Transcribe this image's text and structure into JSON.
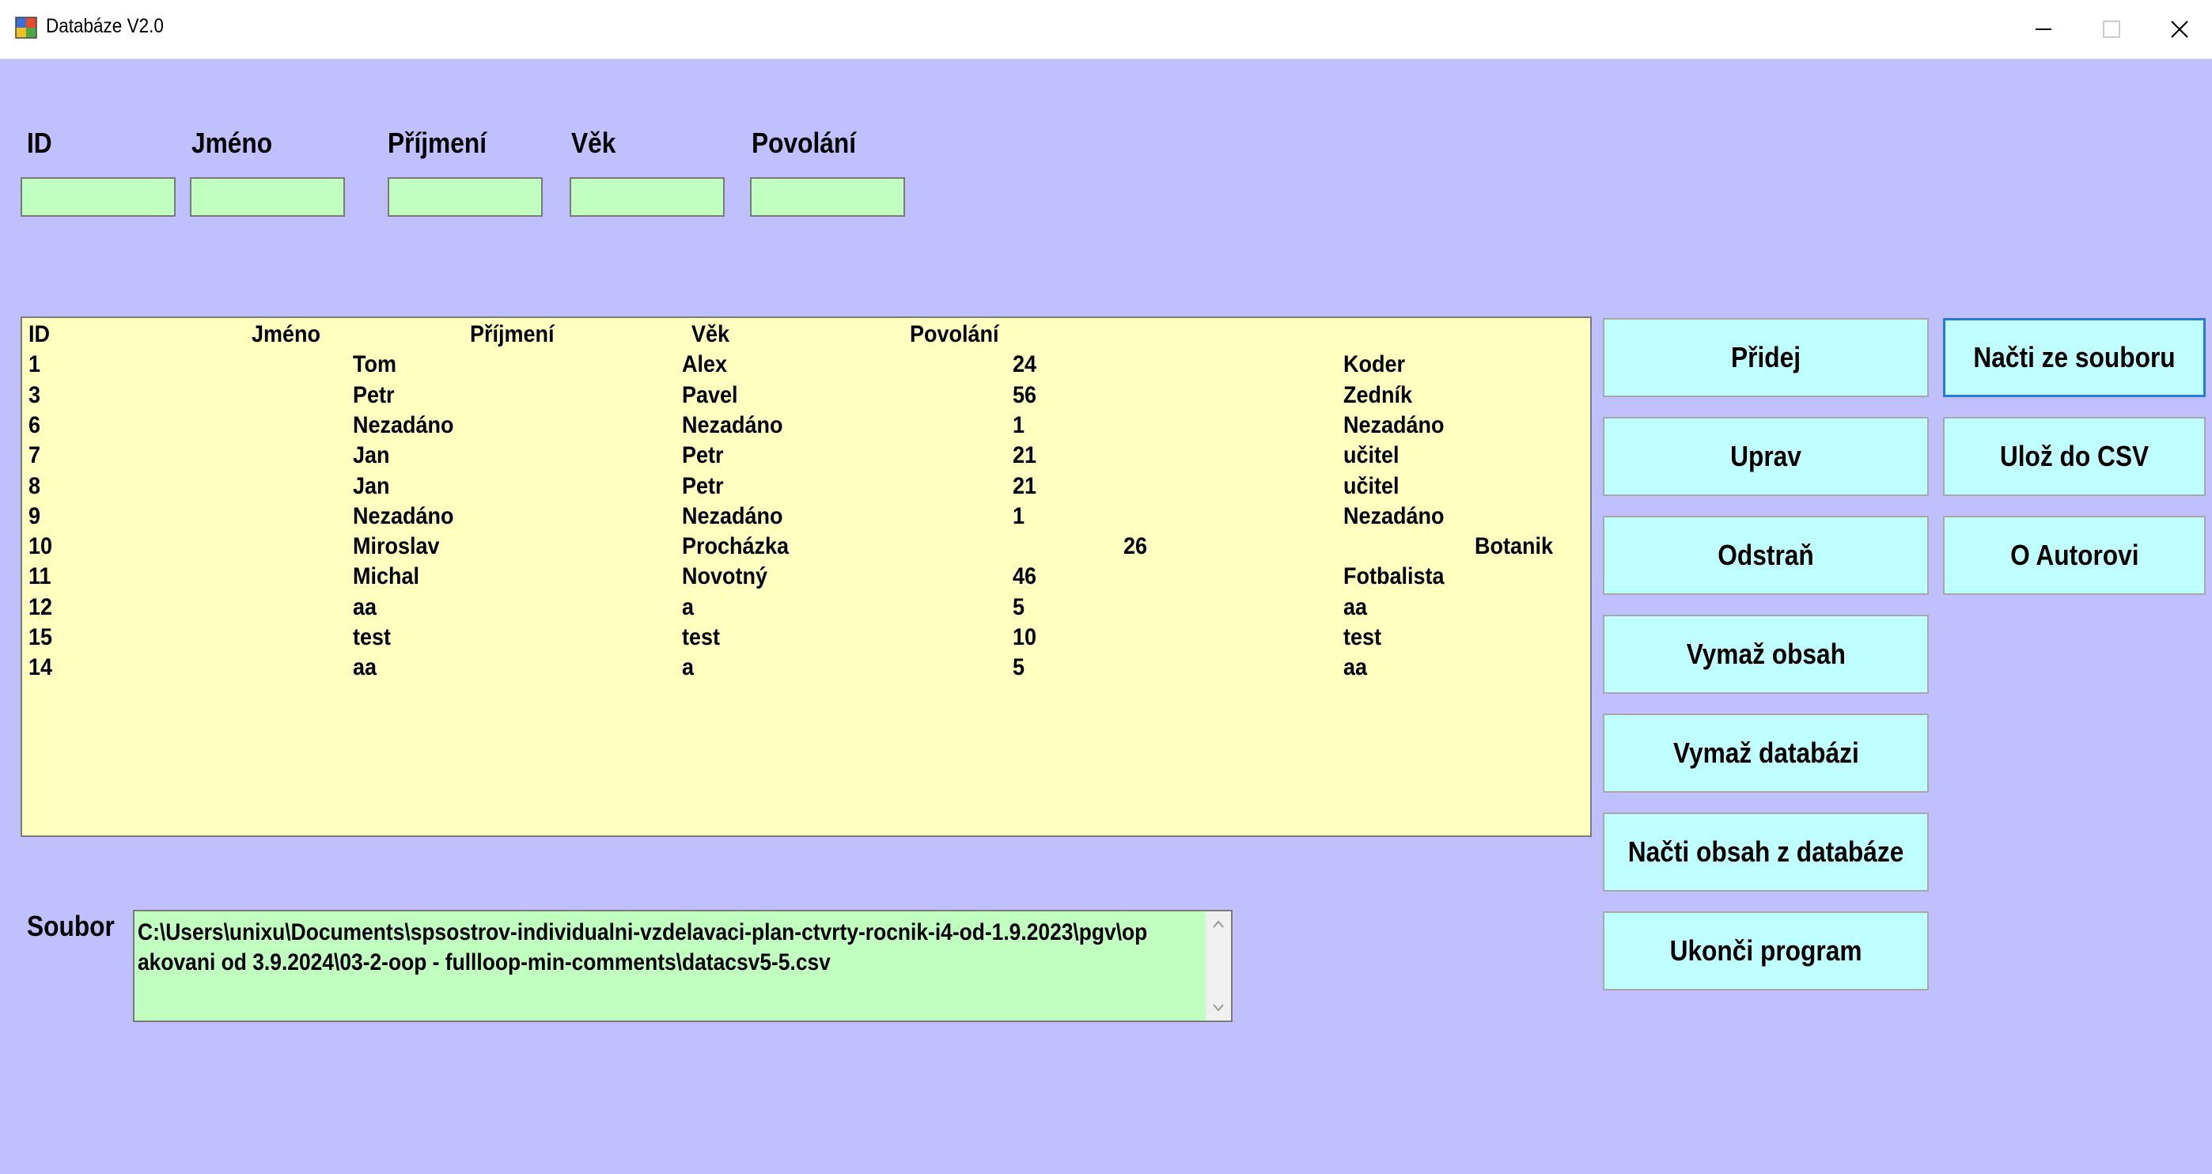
{
  "window": {
    "title": "Databáze V2.0"
  },
  "fields": [
    {
      "label": "ID",
      "value": ""
    },
    {
      "label": "Jméno",
      "value": ""
    },
    {
      "label": "Příjmení",
      "value": ""
    },
    {
      "label": "Věk",
      "value": ""
    },
    {
      "label": "Povolání",
      "value": ""
    }
  ],
  "list": {
    "header": [
      "ID",
      "Jméno",
      "Příjmení",
      "Věk",
      "Povolání"
    ],
    "rows": [
      [
        "1",
        "Tom",
        "Alex",
        "24",
        "Koder"
      ],
      [
        "3",
        "Petr",
        "Pavel",
        "56",
        "Zedník"
      ],
      [
        "6",
        "Nezadáno",
        "Nezadáno",
        "1",
        "Nezadáno"
      ],
      [
        "7",
        "Jan",
        "Petr",
        "21",
        "učitel"
      ],
      [
        "8",
        "Jan",
        "Petr",
        "21",
        "učitel"
      ],
      [
        "9",
        "Nezadáno",
        "Nezadáno",
        "1",
        "Nezadáno"
      ],
      [
        "10",
        "Miroslav",
        "Procházka",
        "26",
        "Botanik"
      ],
      [
        "11",
        "Michal",
        "Novotný",
        "46",
        "Fotbalista"
      ],
      [
        "12",
        "aa",
        "a",
        "5",
        "aa"
      ],
      [
        "15",
        "test",
        "test",
        "10",
        "test"
      ],
      [
        "14",
        "aa",
        "a",
        "5",
        "aa"
      ]
    ]
  },
  "buttons": {
    "pridej": "Přidej",
    "uprav": "Uprav",
    "odstran": "Odstraň",
    "vymaz_obsah": "Vymaž obsah",
    "vymaz_databazi": "Vymaž databázi",
    "nacti_obsah_z_databaze": "Načti obsah z databáze",
    "ukonci_program": "Ukonči program",
    "nacti_ze_souboru": "Načti ze souboru",
    "uloz_do_csv": "Ulož do CSV",
    "o_autorovi": "O Autorovi"
  },
  "soubor": {
    "label": "Soubor",
    "path": "C:\\Users\\unixu\\Documents\\spsostrov-individualni-vzdelavaci-plan-ctvrty-rocnik-i4-od-1.9.2023\\pgv\\opakovani od 3.9.2024\\03-2-oop - fullloop-min-comments\\datacsv5-5.csv"
  },
  "colors": {
    "background": "#c0c0ff",
    "input": "#c0ffc0",
    "list": "#ffffc0",
    "button": "#c0ffff"
  }
}
